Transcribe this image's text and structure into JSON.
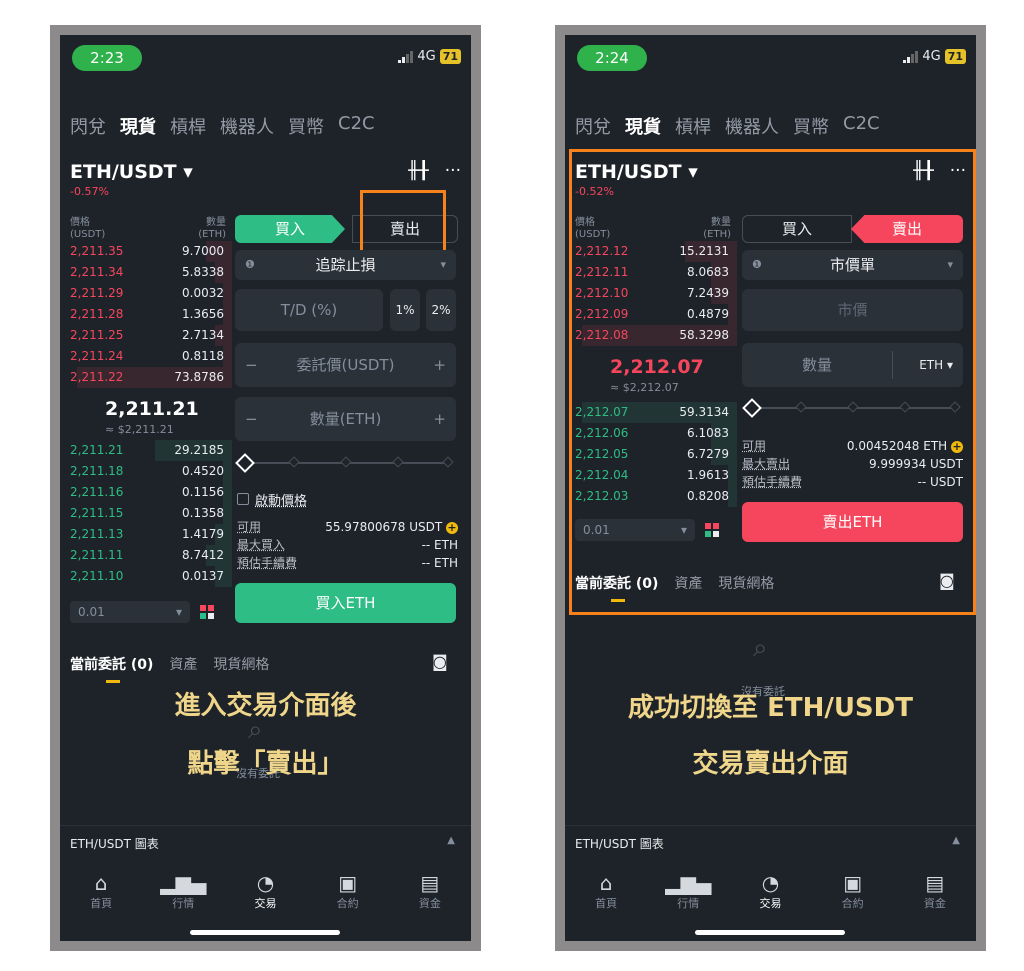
{
  "colors": {
    "bg": "#1e2329",
    "buy": "#2ebd85",
    "sell": "#f6465d",
    "highlight": "#f7821b",
    "caption": "#f0d68a"
  },
  "left": {
    "status": {
      "time": "2:23",
      "network": "4G",
      "battery": "71"
    },
    "tabs": [
      "閃兌",
      "現貨",
      "槓桿",
      "機器人",
      "買幣",
      "C2C"
    ],
    "pair": "ETH/USDT ▾",
    "change": "-0.57%",
    "ob_header": {
      "price": "價格",
      "price_unit": "(USDT)",
      "qty": "數量",
      "qty_unit": "(ETH)"
    },
    "asks": [
      {
        "p": "2,211.35",
        "q": "9.7000",
        "d": 0.15
      },
      {
        "p": "2,211.34",
        "q": "5.8338",
        "d": 0.1
      },
      {
        "p": "2,211.29",
        "q": "0.0032",
        "d": 0.05
      },
      {
        "p": "2,211.28",
        "q": "1.3656",
        "d": 0.05
      },
      {
        "p": "2,211.25",
        "q": "2.7134",
        "d": 0.1
      },
      {
        "p": "2,211.24",
        "q": "0.8118",
        "d": 0.05
      },
      {
        "p": "2,211.22",
        "q": "73.8786",
        "d": 0.9
      }
    ],
    "mid_price": "2,211.21",
    "mid_fiat": "≈ $2,211.21",
    "bids": [
      {
        "p": "2,211.21",
        "q": "29.2185",
        "d": 0.45
      },
      {
        "p": "2,211.18",
        "q": "0.4520",
        "d": 0.05
      },
      {
        "p": "2,211.16",
        "q": "0.1156",
        "d": 0.05
      },
      {
        "p": "2,211.15",
        "q": "0.1358",
        "d": 0.05
      },
      {
        "p": "2,211.13",
        "q": "1.4179",
        "d": 0.1
      },
      {
        "p": "2,211.11",
        "q": "8.7412",
        "d": 0.15
      },
      {
        "p": "2,211.10",
        "q": "0.0137",
        "d": 0.1
      }
    ],
    "depth": "0.01",
    "buy_tab": "買入",
    "sell_tab": "賣出",
    "order_type": "追踪止損",
    "td_placeholder": "T/D (%)",
    "pct1": "1%",
    "pct2": "2%",
    "price_field": "委託價(USDT)",
    "qty_field": "數量(ETH)",
    "activate": "啟動價格",
    "avail_label": "可用",
    "avail_value": "55.97800678 USDT",
    "max_label": "最大買入",
    "max_value": "-- ETH",
    "fee_label": "預估手續費",
    "fee_value": "-- ETH",
    "action": "買入ETH",
    "bottom_tabs": [
      "當前委託 (0)",
      "資產",
      "現貨網格"
    ],
    "empty_text": "沒有委託",
    "chart_bar": "ETH/USDT 圖表",
    "nav": [
      "首頁",
      "行情",
      "交易",
      "合約",
      "資金"
    ],
    "caption": [
      "進入交易介面後",
      "點擊「賣出」"
    ]
  },
  "right": {
    "status": {
      "time": "2:24",
      "network": "4G",
      "battery": "71"
    },
    "tabs": [
      "閃兌",
      "現貨",
      "槓桿",
      "機器人",
      "買幣",
      "C2C"
    ],
    "pair": "ETH/USDT ▾",
    "change": "-0.52%",
    "ob_header": {
      "price": "價格",
      "price_unit": "(USDT)",
      "qty": "數量",
      "qty_unit": "(ETH)"
    },
    "asks": [
      {
        "p": "2,212.12",
        "q": "15.2131",
        "d": 0.3
      },
      {
        "p": "2,212.11",
        "q": "8.0683",
        "d": 0.15
      },
      {
        "p": "2,212.10",
        "q": "7.2439",
        "d": 0.15
      },
      {
        "p": "2,212.09",
        "q": "0.4879",
        "d": 0.05
      },
      {
        "p": "2,212.08",
        "q": "58.3298",
        "d": 0.9
      }
    ],
    "mid_price": "2,212.07",
    "mid_fiat": "≈ $2,212.07",
    "bids": [
      {
        "p": "2,212.07",
        "q": "59.3134",
        "d": 0.9
      },
      {
        "p": "2,212.06",
        "q": "6.1083",
        "d": 0.15
      },
      {
        "p": "2,212.05",
        "q": "6.7279",
        "d": 0.15
      },
      {
        "p": "2,212.04",
        "q": "1.9613",
        "d": 0.05
      },
      {
        "p": "2,212.03",
        "q": "0.8208",
        "d": 0.05
      }
    ],
    "depth": "0.01",
    "buy_tab": "買入",
    "sell_tab": "賣出",
    "order_type": "市價單",
    "market_field": "市價",
    "qty_field": "數量",
    "qty_unit": "ETH",
    "avail_label": "可用",
    "avail_value": "0.00452048 ETH",
    "max_label": "最大賣出",
    "max_value": "9.999934 USDT",
    "fee_label": "預估手續費",
    "fee_value": "-- USDT",
    "action": "賣出ETH",
    "bottom_tabs": [
      "當前委託 (0)",
      "資產",
      "現貨網格"
    ],
    "empty_text": "沒有委託",
    "chart_bar": "ETH/USDT 圖表",
    "nav": [
      "首頁",
      "行情",
      "交易",
      "合約",
      "資金"
    ],
    "caption": [
      "成功切換至 ETH/USDT",
      "交易賣出介面"
    ]
  }
}
